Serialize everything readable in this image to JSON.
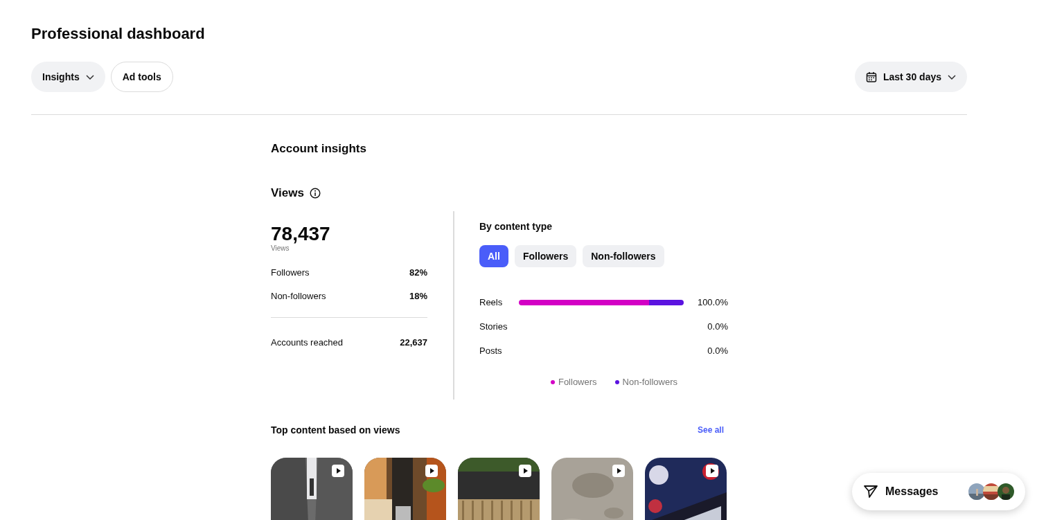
{
  "page_title": "Professional dashboard",
  "header_buttons": [
    {
      "label": "Insights",
      "kind": "dropdown"
    },
    {
      "label": "Ad tools",
      "kind": "plain"
    }
  ],
  "date_range": {
    "label": "Last 30 days"
  },
  "section_title": "Account insights",
  "views": {
    "title": "Views",
    "total": "78,437",
    "total_label": "Views",
    "breakdown": [
      {
        "label": "Followers",
        "value": "82%"
      },
      {
        "label": "Non-followers",
        "value": "18%"
      }
    ],
    "accounts_reached": {
      "label": "Accounts reached",
      "value": "22,637"
    }
  },
  "by_content_type": {
    "title": "By content type",
    "filters": [
      {
        "label": "All",
        "selected": true
      },
      {
        "label": "Followers",
        "selected": false
      },
      {
        "label": "Non-followers",
        "selected": false
      }
    ],
    "rows": [
      {
        "label": "Reels",
        "value": "100.0%",
        "segments": [
          {
            "level": 0.79,
            "color": "#d300c5"
          },
          {
            "level": 0.21,
            "color": "#5b13e0"
          }
        ]
      },
      {
        "label": "Stories",
        "value": "0.0%",
        "segments": []
      },
      {
        "label": "Posts",
        "value": "0.0%",
        "segments": []
      }
    ],
    "legend": [
      {
        "label": "Followers",
        "color": "#d300c5"
      },
      {
        "label": "Non-followers",
        "color": "#5b13e0"
      }
    ]
  },
  "top_content": {
    "title": "Top content based on views",
    "see_all": "See all"
  },
  "messages": {
    "label": "Messages"
  }
}
